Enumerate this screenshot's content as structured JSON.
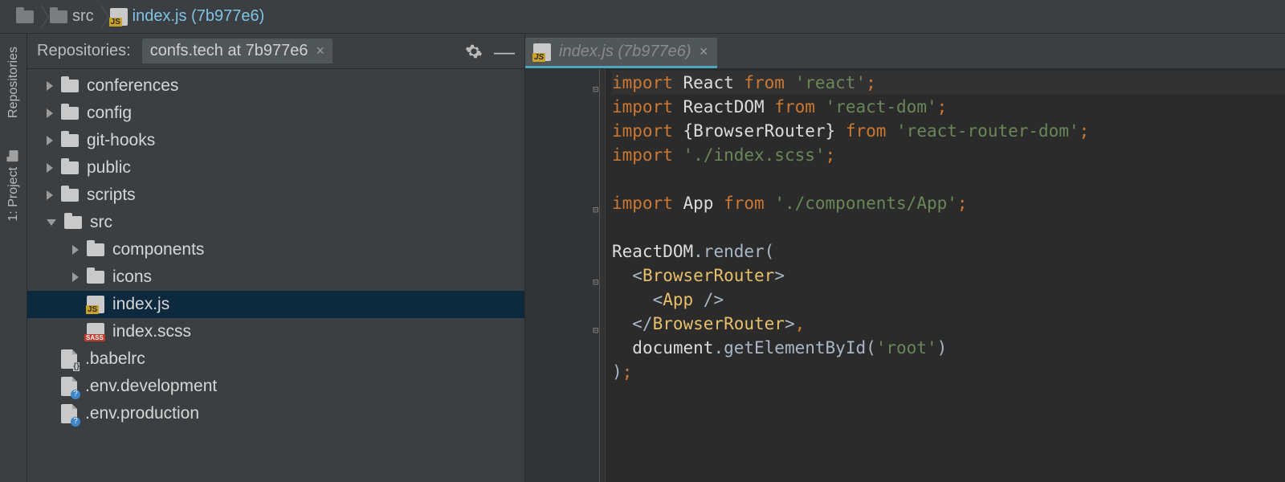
{
  "breadcrumb": {
    "root_icon": "folder-icon",
    "items": [
      {
        "label": "src",
        "kind": "folder"
      },
      {
        "label": "index.js (7b977e6)",
        "kind": "js",
        "link": true
      }
    ]
  },
  "tool_strip": {
    "tabs": [
      {
        "label": "Repositories",
        "icon": "repositories-glyph"
      },
      {
        "label": "1: Project",
        "icon": "project-folder"
      }
    ]
  },
  "panel": {
    "title": "Repositories:",
    "repo_tab": {
      "label": "confs.tech at 7b977e6"
    },
    "tree": [
      {
        "depth": 0,
        "disclosure": "closed",
        "icon": "folder",
        "label": "conferences"
      },
      {
        "depth": 0,
        "disclosure": "closed",
        "icon": "folder",
        "label": "config"
      },
      {
        "depth": 0,
        "disclosure": "closed",
        "icon": "folder",
        "label": "git-hooks"
      },
      {
        "depth": 0,
        "disclosure": "closed",
        "icon": "folder",
        "label": "public"
      },
      {
        "depth": 0,
        "disclosure": "closed",
        "icon": "folder",
        "label": "scripts"
      },
      {
        "depth": 0,
        "disclosure": "open",
        "icon": "folder",
        "label": "src"
      },
      {
        "depth": 1,
        "disclosure": "closed",
        "icon": "folder",
        "label": "components"
      },
      {
        "depth": 1,
        "disclosure": "closed",
        "icon": "folder",
        "label": "icons"
      },
      {
        "depth": 1,
        "disclosure": "none",
        "icon": "js",
        "label": "index.js",
        "selected": true
      },
      {
        "depth": 1,
        "disclosure": "none",
        "icon": "scss",
        "label": "index.scss"
      },
      {
        "depth": 0,
        "disclosure": "none",
        "icon": "file-braces",
        "label": ".babelrc"
      },
      {
        "depth": 0,
        "disclosure": "none",
        "icon": "file-q",
        "label": ".env.development"
      },
      {
        "depth": 0,
        "disclosure": "none",
        "icon": "file-q",
        "label": ".env.production"
      }
    ]
  },
  "editor": {
    "tab": {
      "label": "index.js (7b977e6)"
    },
    "code": {
      "lines": [
        {
          "folds": "−",
          "tokens": [
            {
              "t": "kw",
              "v": "import "
            },
            {
              "t": "white",
              "v": "React "
            },
            {
              "t": "kw",
              "v": "from "
            },
            {
              "t": "str",
              "v": "'react'"
            },
            {
              "t": "pun",
              "v": ";"
            }
          ],
          "current": true
        },
        {
          "tokens": [
            {
              "t": "kw",
              "v": "import "
            },
            {
              "t": "white",
              "v": "ReactDOM "
            },
            {
              "t": "kw",
              "v": "from "
            },
            {
              "t": "str",
              "v": "'react-dom'"
            },
            {
              "t": "pun",
              "v": ";"
            }
          ]
        },
        {
          "tokens": [
            {
              "t": "kw",
              "v": "import "
            },
            {
              "t": "white",
              "v": "{BrowserRouter} "
            },
            {
              "t": "kw",
              "v": "from "
            },
            {
              "t": "str",
              "v": "'react-router-dom'"
            },
            {
              "t": "pun",
              "v": ";"
            }
          ]
        },
        {
          "tokens": [
            {
              "t": "kw",
              "v": "import "
            },
            {
              "t": "str",
              "v": "'./index.scss'"
            },
            {
              "t": "pun",
              "v": ";"
            }
          ]
        },
        {
          "tokens": []
        },
        {
          "folds": "−",
          "tokens": [
            {
              "t": "kw",
              "v": "import "
            },
            {
              "t": "white",
              "v": "App "
            },
            {
              "t": "kw",
              "v": "from "
            },
            {
              "t": "str",
              "v": "'./components/App'"
            },
            {
              "t": "pun",
              "v": ";"
            }
          ]
        },
        {
          "tokens": []
        },
        {
          "tokens": [
            {
              "t": "white",
              "v": "ReactDOM"
            },
            {
              "t": "id",
              "v": ".render("
            }
          ]
        },
        {
          "folds": "−",
          "tokens": [
            {
              "t": "id",
              "v": "  <"
            },
            {
              "t": "jsxTag",
              "v": "BrowserRouter"
            },
            {
              "t": "id",
              "v": ">"
            }
          ]
        },
        {
          "tokens": [
            {
              "t": "id",
              "v": "    <"
            },
            {
              "t": "jsxTag",
              "v": "App "
            },
            {
              "t": "id",
              "v": "/>"
            }
          ]
        },
        {
          "folds": "⌃",
          "tokens": [
            {
              "t": "id",
              "v": "  </"
            },
            {
              "t": "jsxTag",
              "v": "BrowserRouter"
            },
            {
              "t": "id",
              "v": ">"
            },
            {
              "t": "pun",
              "v": ","
            }
          ]
        },
        {
          "tokens": [
            {
              "t": "id",
              "v": "  "
            },
            {
              "t": "white",
              "v": "document"
            },
            {
              "t": "id",
              "v": ".getElementById("
            },
            {
              "t": "str",
              "v": "'root'"
            },
            {
              "t": "id",
              "v": ")"
            }
          ]
        },
        {
          "tokens": [
            {
              "t": "id",
              "v": ")"
            },
            {
              "t": "pun",
              "v": ";"
            }
          ]
        }
      ]
    }
  }
}
